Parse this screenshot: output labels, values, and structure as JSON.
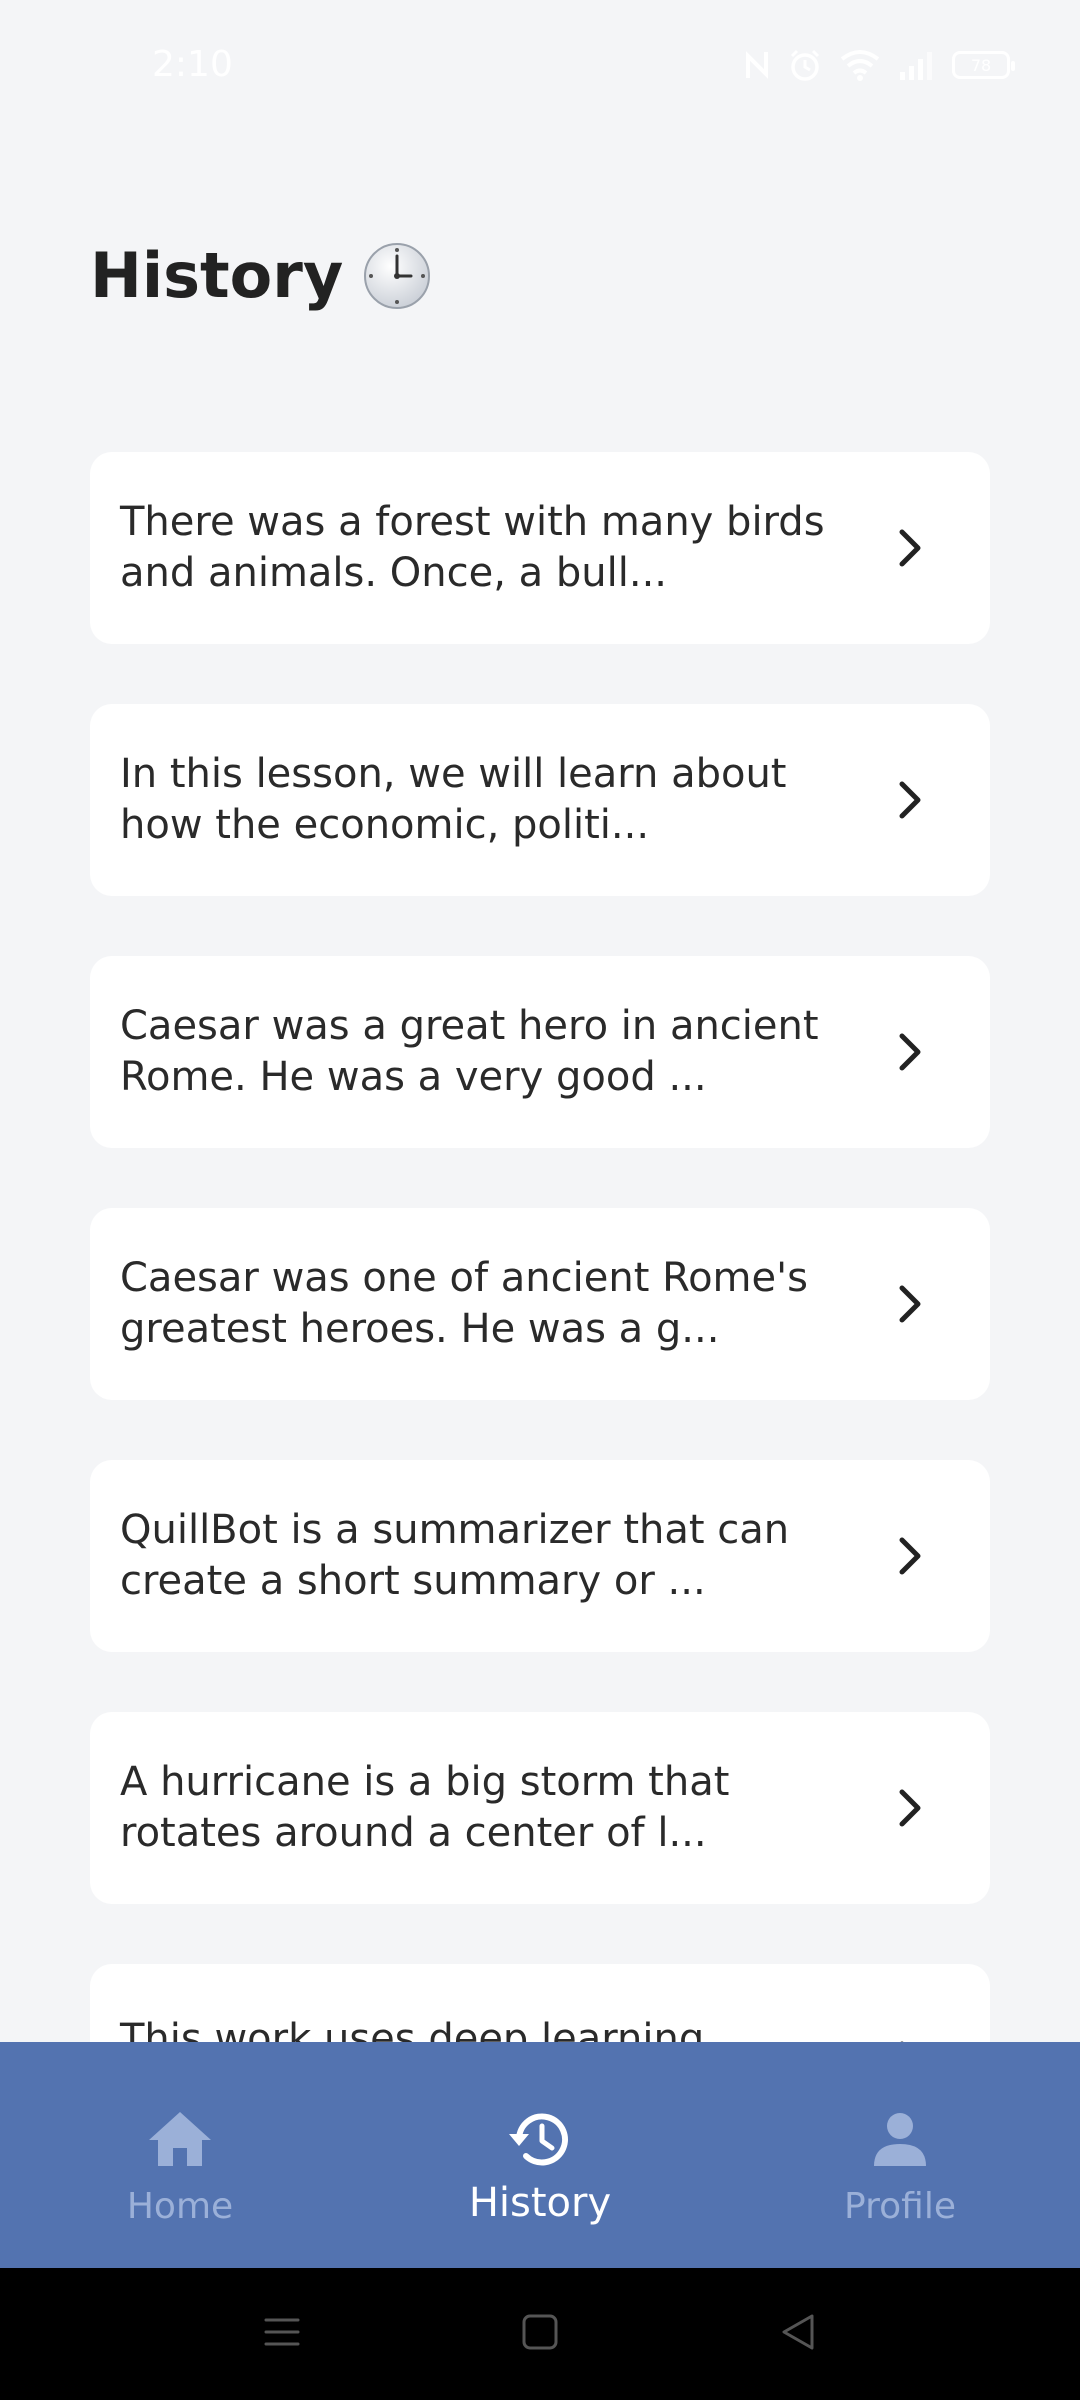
{
  "status_bar": {
    "time": "2:10",
    "battery": "78"
  },
  "header": {
    "title": "History",
    "title_icon": "clock-icon"
  },
  "history": {
    "items": [
      {
        "text": "There was a forest with many birds and animals. Once, a bull..."
      },
      {
        "text": "In this lesson, we will learn about how the economic, politi..."
      },
      {
        "text": "Caesar was a great hero in ancient Rome. He was a very good ..."
      },
      {
        "text": "Caesar was one of ancient Rome's greatest heroes. He was a g..."
      },
      {
        "text": "QuillBot is a summarizer that can create a short summary or ..."
      },
      {
        "text": "A hurricane is a big storm that rotates around a center of l..."
      },
      {
        "text": "This work uses deep learning"
      }
    ]
  },
  "bottom_nav": {
    "home": "Home",
    "history": "History",
    "profile": "Profile",
    "active": "history"
  },
  "colors": {
    "accent": "#5373b0",
    "background": "#f4f5f7",
    "card": "#ffffff"
  }
}
